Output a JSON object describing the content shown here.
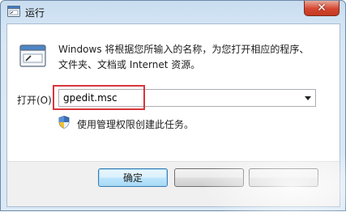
{
  "window": {
    "title": "运行",
    "close_symbol": "✕",
    "title_icon": "run-app-icon",
    "close_icon": "close-icon"
  },
  "description": {
    "line1": "Windows 将根据您所输入的名称，为您打开相应的程序、",
    "line2": "文件夹、文档或 Internet 资源。"
  },
  "open_field": {
    "label": "打开(O):",
    "value": "gpedit.msc"
  },
  "admin_note": "使用管理权限创建此任务。",
  "buttons": {
    "ok_label": "确定",
    "second_label": "",
    "third_label": ""
  },
  "colors": {
    "highlight_border": "#d8353b",
    "close_button": "#c33b22"
  }
}
